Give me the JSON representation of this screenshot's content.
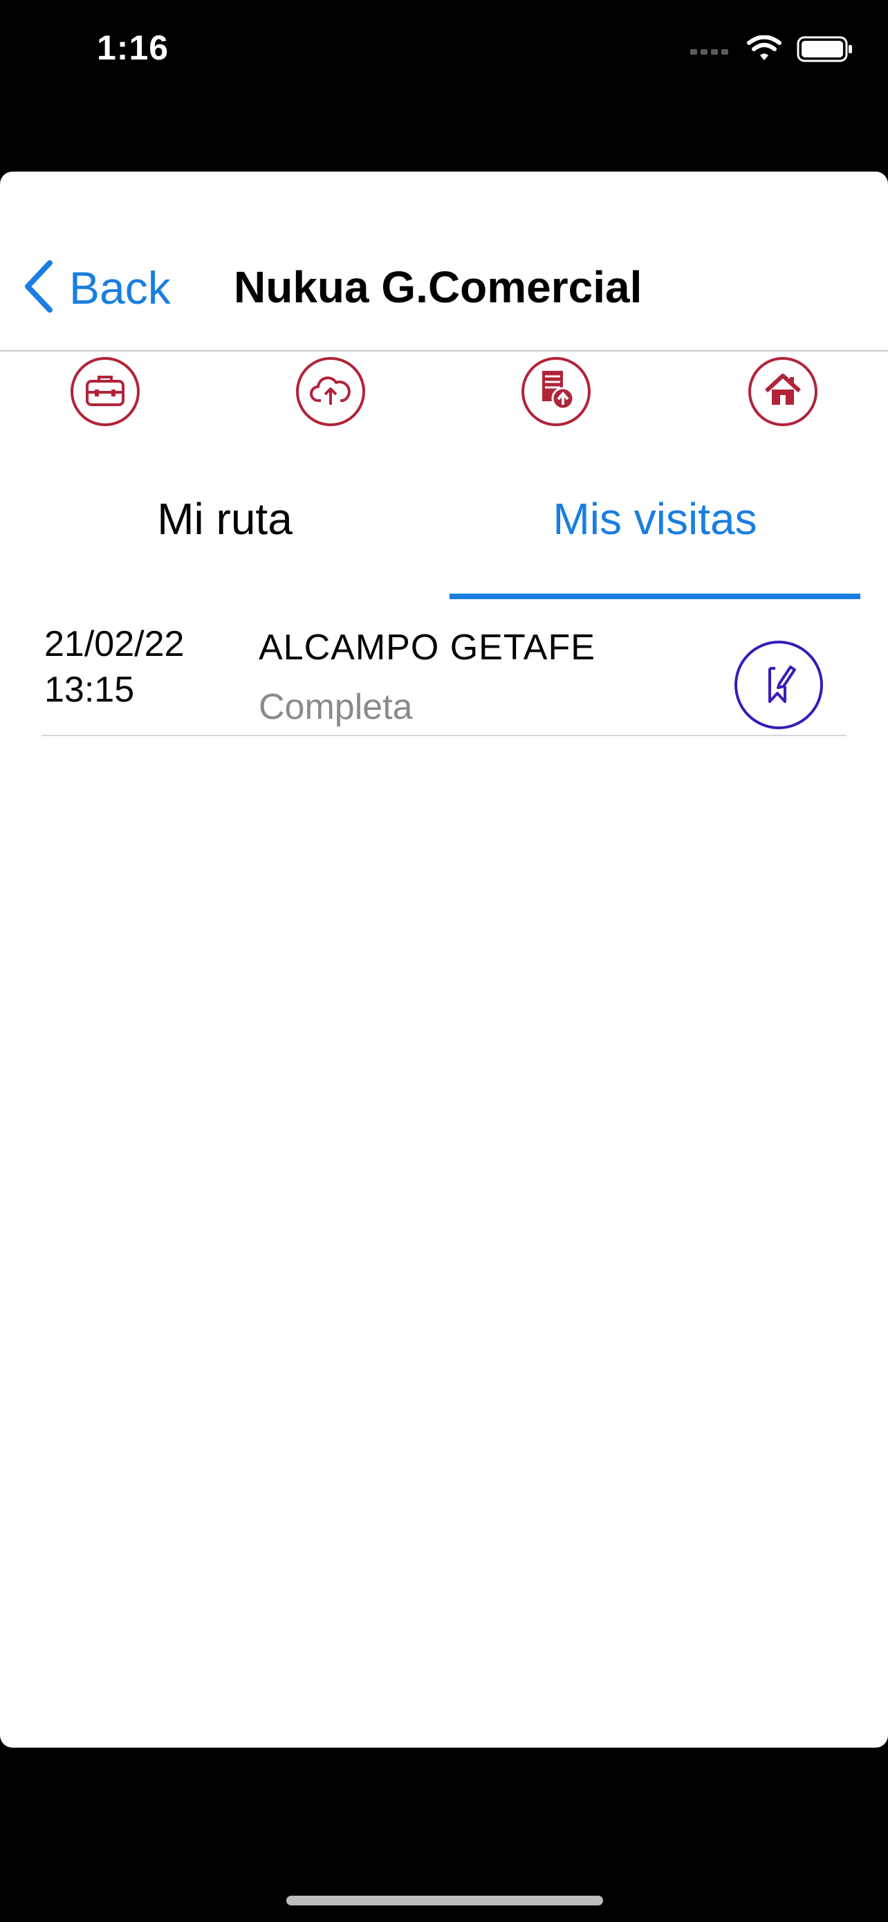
{
  "status_bar": {
    "time": "1:16"
  },
  "nav": {
    "back_label": "Back",
    "title": "Nukua G.Comercial"
  },
  "toolbar": {
    "icons": [
      "briefcase-icon",
      "cloud-upload-icon",
      "document-upload-icon",
      "home-icon"
    ],
    "accent_color": "#b0243a"
  },
  "tabs": [
    {
      "label": "Mi ruta",
      "active": false
    },
    {
      "label": "Mis visitas",
      "active": true
    }
  ],
  "visits": [
    {
      "date": "21/02/22",
      "time": "13:15",
      "name": "ALCAMPO GETAFE",
      "status": "Completa",
      "action_icon": "edit-bookmark-icon"
    }
  ],
  "colors": {
    "link_blue": "#1a7ee0",
    "action_purple": "#3a1bb8",
    "muted_gray": "#8a8a8e"
  }
}
